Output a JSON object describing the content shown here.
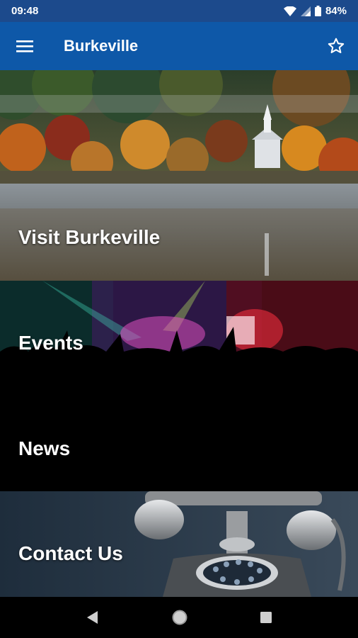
{
  "status_bar": {
    "time": "09:48",
    "battery": "84%"
  },
  "app_bar": {
    "title": "Burkeville",
    "menu_icon": "hamburger-menu-icon",
    "favorite_icon": "star-outline-icon"
  },
  "tiles": [
    {
      "label": "Visit Burkeville",
      "image": "autumn-lake-church-photo"
    },
    {
      "label": "Events",
      "image": "concert-crowd-photo"
    },
    {
      "label": "News",
      "image": ""
    },
    {
      "label": "Contact Us",
      "image": "vintage-rotary-telephone-photo"
    }
  ],
  "nav_bar": {
    "icons": [
      "back-triangle-icon",
      "home-circle-icon",
      "recents-square-icon"
    ]
  },
  "colors": {
    "status_bar": "#1c4a8c",
    "app_bar": "#0e58a8",
    "nav_bar": "#000000"
  }
}
